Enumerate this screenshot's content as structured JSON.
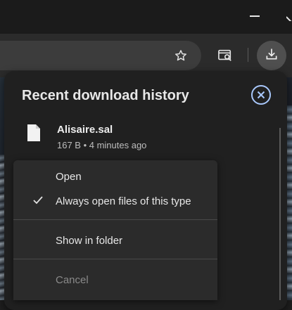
{
  "panel": {
    "title": "Recent download history",
    "close_icon": "close-circle-icon"
  },
  "download": {
    "file_icon": "file-icon",
    "file_name": "Alisaire.sal",
    "meta": "167 B • 4 minutes ago"
  },
  "menu": {
    "items": [
      {
        "label": "Open",
        "checked": false,
        "disabled": false
      },
      {
        "label": "Always open files of this type",
        "checked": true,
        "disabled": false
      },
      {
        "label": "Show in folder",
        "checked": false,
        "disabled": false
      },
      {
        "label": "Cancel",
        "checked": false,
        "disabled": true
      }
    ]
  },
  "toolbar": {
    "icons": [
      "star-icon",
      "tab-search-icon",
      "download-icon"
    ]
  },
  "colors": {
    "accent": "#a8c7fa",
    "panel_bg": "#202020",
    "menu_bg": "#2b2b2b"
  }
}
